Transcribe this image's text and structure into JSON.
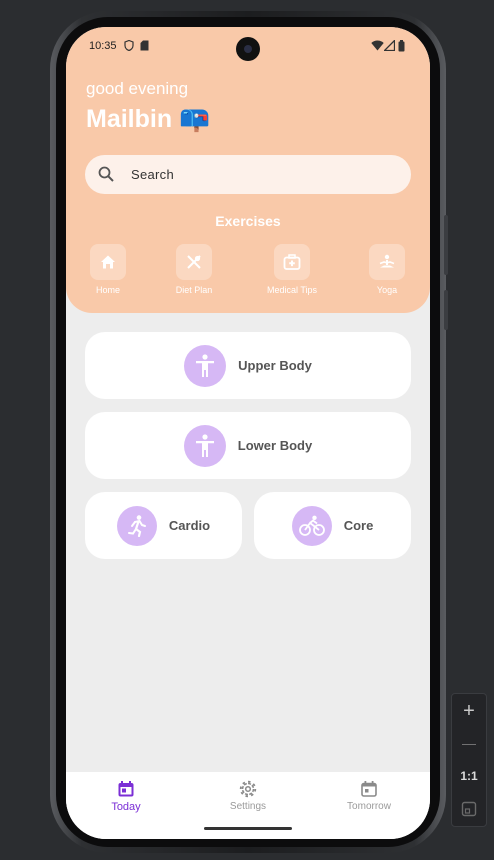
{
  "status_bar": {
    "time": "10:35"
  },
  "header": {
    "greeting": "good evening",
    "username": "Mailbin 📪",
    "search_placeholder": "Search",
    "section_title": "Exercises"
  },
  "categories": [
    {
      "label": "Home",
      "icon": "home-icon"
    },
    {
      "label": "Diet Plan",
      "icon": "utensils-icon"
    },
    {
      "label": "Medical Tips",
      "icon": "medical-kit-icon"
    },
    {
      "label": "Yoga",
      "icon": "yoga-icon"
    }
  ],
  "exercises": [
    {
      "label": "Upper Body",
      "icon": "accessibility-person-icon"
    },
    {
      "label": "Lower Body",
      "icon": "accessibility-person-icon"
    },
    {
      "label": "Cardio",
      "icon": "running-icon"
    },
    {
      "label": "Core",
      "icon": "cycling-icon"
    }
  ],
  "bottom_nav": [
    {
      "label": "Today",
      "icon": "calendar-today-icon",
      "active": true
    },
    {
      "label": "Settings",
      "icon": "gear-icon",
      "active": false
    },
    {
      "label": "Tomorrow",
      "icon": "calendar-icon",
      "active": false
    }
  ],
  "zoom_controls": {
    "zoom_in": "+",
    "zoom_out": "—",
    "reset": "1:1"
  },
  "colors": {
    "header": "#f9c9a9",
    "accent": "#7b2fd6",
    "icon_circle": "#d6b8f5",
    "background": "#ededed"
  }
}
